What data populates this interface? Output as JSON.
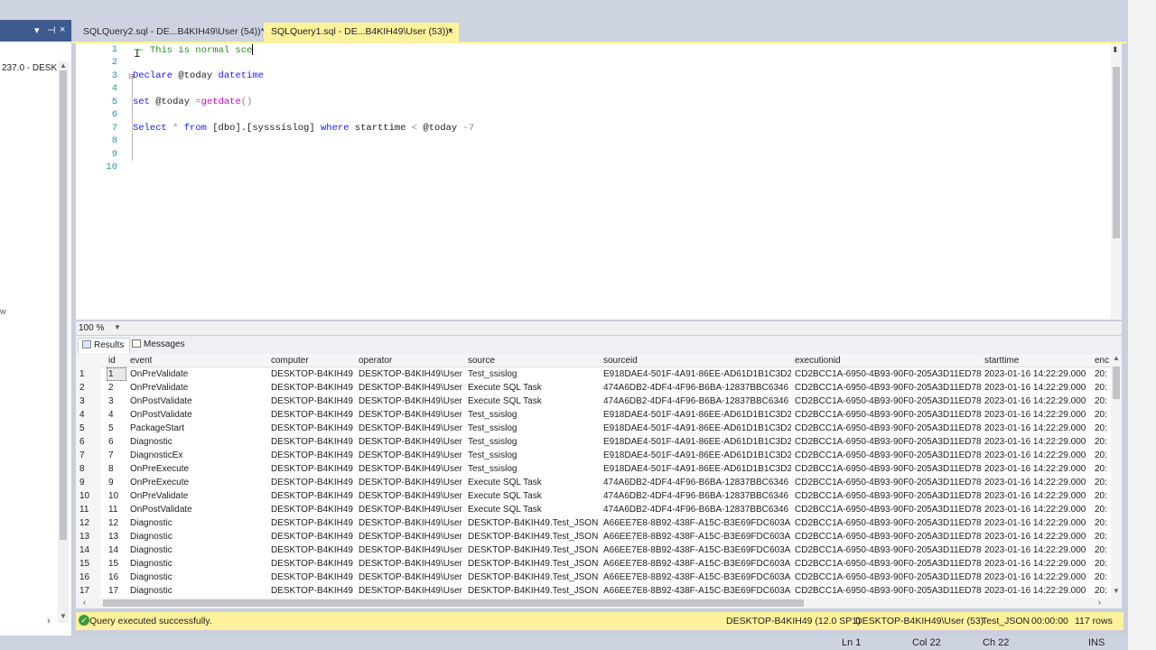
{
  "tabs": [
    {
      "label": "SQLQuery2.sql - DE...B4KIH49\\User (54))*",
      "active": false
    },
    {
      "label": "SQLQuery1.sql - DE...B4KIH49\\User (53))*",
      "active": true,
      "close": "×"
    }
  ],
  "left_panel": {
    "controls": [
      "▾",
      "⊣",
      "×"
    ],
    "tree_text": "237.0 - DESK",
    "edge_text": "w"
  },
  "editor": {
    "line_numbers": [
      "1",
      "2",
      "3",
      "4",
      "5",
      "6",
      "7",
      "8",
      "9",
      "10"
    ],
    "lines": {
      "l1_comment": "-- This is normal sce",
      "l3_kw": "Declare",
      "l3_var": " @today ",
      "l3_type": "datetime",
      "l5_kw": "set",
      "l5_var": " @today ",
      "l5_eq": "=",
      "l5_fn": "getdate",
      "l5_paren": "()",
      "l7_select": "Select",
      "l7_star": " * ",
      "l7_from": "from",
      "l7_obj": " [dbo].[sysssislog] ",
      "l7_where": "where",
      "l7_cond": " starttime ",
      "l7_lt": "<",
      "l7_var": " @today ",
      "l7_minus": "-7"
    },
    "zoom": "100 %"
  },
  "results": {
    "tabs": [
      "Results",
      "Messages"
    ],
    "columns": [
      "id",
      "event",
      "computer",
      "operator",
      "source",
      "sourceid",
      "executionid",
      "starttime",
      "enc"
    ],
    "rows": [
      [
        "1",
        "1",
        "OnPreValidate",
        "DESKTOP-B4KIH49",
        "DESKTOP-B4KIH49\\User",
        "Test_ssislog",
        "E918DAE4-501F-4A91-86EE-AD61D1B1C3D2",
        "CD2BCC1A-6950-4B93-90F0-205A3D11ED78",
        "2023-01-16 14:22:29.000",
        "20:"
      ],
      [
        "2",
        "2",
        "OnPreValidate",
        "DESKTOP-B4KIH49",
        "DESKTOP-B4KIH49\\User",
        "Execute SQL Task",
        "474A6DB2-4DF4-4F96-B6BA-12837BBC6346",
        "CD2BCC1A-6950-4B93-90F0-205A3D11ED78",
        "2023-01-16 14:22:29.000",
        "20:"
      ],
      [
        "3",
        "3",
        "OnPostValidate",
        "DESKTOP-B4KIH49",
        "DESKTOP-B4KIH49\\User",
        "Execute SQL Task",
        "474A6DB2-4DF4-4F96-B6BA-12837BBC6346",
        "CD2BCC1A-6950-4B93-90F0-205A3D11ED78",
        "2023-01-16 14:22:29.000",
        "20:"
      ],
      [
        "4",
        "4",
        "OnPostValidate",
        "DESKTOP-B4KIH49",
        "DESKTOP-B4KIH49\\User",
        "Test_ssislog",
        "E918DAE4-501F-4A91-86EE-AD61D1B1C3D2",
        "CD2BCC1A-6950-4B93-90F0-205A3D11ED78",
        "2023-01-16 14:22:29.000",
        "20:"
      ],
      [
        "5",
        "5",
        "PackageStart",
        "DESKTOP-B4KIH49",
        "DESKTOP-B4KIH49\\User",
        "Test_ssislog",
        "E918DAE4-501F-4A91-86EE-AD61D1B1C3D2",
        "CD2BCC1A-6950-4B93-90F0-205A3D11ED78",
        "2023-01-16 14:22:29.000",
        "20:"
      ],
      [
        "6",
        "6",
        "Diagnostic",
        "DESKTOP-B4KIH49",
        "DESKTOP-B4KIH49\\User",
        "Test_ssislog",
        "E918DAE4-501F-4A91-86EE-AD61D1B1C3D2",
        "CD2BCC1A-6950-4B93-90F0-205A3D11ED78",
        "2023-01-16 14:22:29.000",
        "20:"
      ],
      [
        "7",
        "7",
        "DiagnosticEx",
        "DESKTOP-B4KIH49",
        "DESKTOP-B4KIH49\\User",
        "Test_ssislog",
        "E918DAE4-501F-4A91-86EE-AD61D1B1C3D2",
        "CD2BCC1A-6950-4B93-90F0-205A3D11ED78",
        "2023-01-16 14:22:29.000",
        "20:"
      ],
      [
        "8",
        "8",
        "OnPreExecute",
        "DESKTOP-B4KIH49",
        "DESKTOP-B4KIH49\\User",
        "Test_ssislog",
        "E918DAE4-501F-4A91-86EE-AD61D1B1C3D2",
        "CD2BCC1A-6950-4B93-90F0-205A3D11ED78",
        "2023-01-16 14:22:29.000",
        "20:"
      ],
      [
        "9",
        "9",
        "OnPreExecute",
        "DESKTOP-B4KIH49",
        "DESKTOP-B4KIH49\\User",
        "Execute SQL Task",
        "474A6DB2-4DF4-4F96-B6BA-12837BBC6346",
        "CD2BCC1A-6950-4B93-90F0-205A3D11ED78",
        "2023-01-16 14:22:29.000",
        "20:"
      ],
      [
        "10",
        "10",
        "OnPreValidate",
        "DESKTOP-B4KIH49",
        "DESKTOP-B4KIH49\\User",
        "Execute SQL Task",
        "474A6DB2-4DF4-4F96-B6BA-12837BBC6346",
        "CD2BCC1A-6950-4B93-90F0-205A3D11ED78",
        "2023-01-16 14:22:29.000",
        "20:"
      ],
      [
        "11",
        "11",
        "OnPostValidate",
        "DESKTOP-B4KIH49",
        "DESKTOP-B4KIH49\\User",
        "Execute SQL Task",
        "474A6DB2-4DF4-4F96-B6BA-12837BBC6346",
        "CD2BCC1A-6950-4B93-90F0-205A3D11ED78",
        "2023-01-16 14:22:29.000",
        "20:"
      ],
      [
        "12",
        "12",
        "Diagnostic",
        "DESKTOP-B4KIH49",
        "DESKTOP-B4KIH49\\User",
        "DESKTOP-B4KIH49.Test_JSON",
        "A66EE7E8-8B92-438F-A15C-B3E69FDC603A",
        "CD2BCC1A-6950-4B93-90F0-205A3D11ED78",
        "2023-01-16 14:22:29.000",
        "20:"
      ],
      [
        "13",
        "13",
        "Diagnostic",
        "DESKTOP-B4KIH49",
        "DESKTOP-B4KIH49\\User",
        "DESKTOP-B4KIH49.Test_JSON",
        "A66EE7E8-8B92-438F-A15C-B3E69FDC603A",
        "CD2BCC1A-6950-4B93-90F0-205A3D11ED78",
        "2023-01-16 14:22:29.000",
        "20:"
      ],
      [
        "14",
        "14",
        "Diagnostic",
        "DESKTOP-B4KIH49",
        "DESKTOP-B4KIH49\\User",
        "DESKTOP-B4KIH49.Test_JSON",
        "A66EE7E8-8B92-438F-A15C-B3E69FDC603A",
        "CD2BCC1A-6950-4B93-90F0-205A3D11ED78",
        "2023-01-16 14:22:29.000",
        "20:"
      ],
      [
        "15",
        "15",
        "Diagnostic",
        "DESKTOP-B4KIH49",
        "DESKTOP-B4KIH49\\User",
        "DESKTOP-B4KIH49.Test_JSON",
        "A66EE7E8-8B92-438F-A15C-B3E69FDC603A",
        "CD2BCC1A-6950-4B93-90F0-205A3D11ED78",
        "2023-01-16 14:22:29.000",
        "20:"
      ],
      [
        "16",
        "16",
        "Diagnostic",
        "DESKTOP-B4KIH49",
        "DESKTOP-B4KIH49\\User",
        "DESKTOP-B4KIH49.Test_JSON",
        "A66EE7E8-8B92-438F-A15C-B3E69FDC603A",
        "CD2BCC1A-6950-4B93-90F0-205A3D11ED78",
        "2023-01-16 14:22:29.000",
        "20:"
      ],
      [
        "17",
        "17",
        "Diagnostic",
        "DESKTOP-B4KIH49",
        "DESKTOP-B4KIH49\\User",
        "DESKTOP-B4KIH49.Test_JSON",
        "A66EE7E8-8B92-438F-A15C-B3E69FDC603A",
        "CD2BCC1A-6950-4B93-90F0-205A3D11ED78",
        "2023-01-16 14:22:29.000",
        "20:"
      ]
    ]
  },
  "status": {
    "message": "Query executed successfully.",
    "server": "DESKTOP-B4KIH49 (12.0 SP1)",
    "user": "DESKTOP-B4KIH49\\User (53)",
    "database": "Test_JSON",
    "elapsed": "00:00:00",
    "rows": "117 rows"
  },
  "bottom": {
    "ln": "Ln 1",
    "col": "Col 22",
    "ch": "Ch 22",
    "mode": "INS"
  },
  "colors": {
    "accent_yellow": "#fff29d",
    "panel_header": "#3d5a8f",
    "keyword": "#1a1aff",
    "function": "#d100d1",
    "comment": "#2e8b2e"
  }
}
